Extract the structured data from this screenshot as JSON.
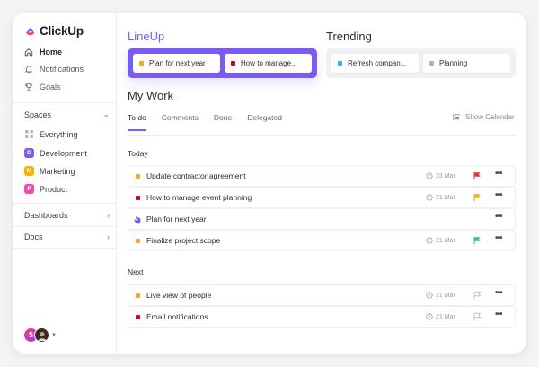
{
  "app": {
    "name": "ClickUp"
  },
  "nav": [
    {
      "label": "Home",
      "icon": "home-icon",
      "active": true
    },
    {
      "label": "Notifications",
      "icon": "bell-icon",
      "active": false
    },
    {
      "label": "Goals",
      "icon": "trophy-icon",
      "active": false
    }
  ],
  "spaces": {
    "label": "Spaces",
    "items": [
      {
        "label": "Everything",
        "badge": "",
        "color": "#b5b5c2"
      },
      {
        "label": "Development",
        "badge": "D",
        "color": "#7b5cf0"
      },
      {
        "label": "Marketing",
        "badge": "M",
        "color": "#f5b400"
      },
      {
        "label": "Product",
        "badge": "P",
        "color": "#f54aa8"
      }
    ]
  },
  "sections": {
    "dashboards": "Dashboards",
    "docs": "Docs"
  },
  "user": {
    "initial": "S"
  },
  "lineup": {
    "title": "LineUp",
    "items": [
      {
        "label": "Plan for next year",
        "color": "#f5a623"
      },
      {
        "label": "How to manage...",
        "color": "#d0021b"
      }
    ]
  },
  "trending": {
    "title": "Trending",
    "items": [
      {
        "label": "Refresh compan...",
        "color": "#29b6f6"
      },
      {
        "label": "Planning",
        "color": "#b0b0bc"
      }
    ]
  },
  "mywork": {
    "title": "My Work",
    "tabs": [
      "To do",
      "Comments",
      "Done",
      "Delegated"
    ],
    "show_calendar": "Show Calendar",
    "groups": [
      {
        "title": "Today",
        "tasks": [
          {
            "name": "Update contractor agreement",
            "color": "#f5a623",
            "date": "23 Mar",
            "flag": "red",
            "flag_color": "#e8323c"
          },
          {
            "name": "How to manage event planning",
            "color": "#d0021b",
            "date": "21 Mar",
            "flag": "orange",
            "flag_color": "#f5a623"
          },
          {
            "name": "Plan for next year",
            "color": "#7b5cf0",
            "date": "",
            "flag": "none",
            "flag_color": ""
          },
          {
            "name": "Finalize project scope",
            "color": "#f5a623",
            "date": "21 Mar",
            "flag": "green",
            "flag_color": "#2ecc71"
          }
        ]
      },
      {
        "title": "Next",
        "tasks": [
          {
            "name": "Live view of people",
            "color": "#f5a623",
            "date": "21 Mar",
            "flag": "empty",
            "flag_color": "#c4c4cf"
          },
          {
            "name": "Email notifications",
            "color": "#d0021b",
            "date": "21 Mar",
            "flag": "empty",
            "flag_color": "#c4c4cf"
          }
        ]
      }
    ]
  },
  "colors": {
    "accent": "#7b5cf0"
  }
}
